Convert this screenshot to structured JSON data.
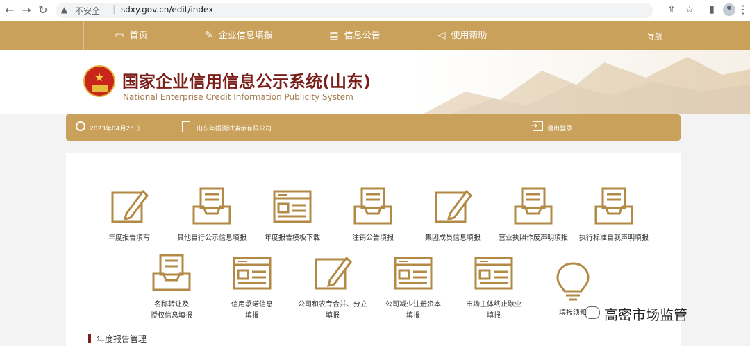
{
  "browser": {
    "insecure_label": "不安全",
    "url": "sdxy.gov.cn/edit/index"
  },
  "nav": {
    "items": [
      {
        "label": "首页",
        "icon": "monitor-icon"
      },
      {
        "label": "企业信息填报",
        "icon": "pen-icon"
      },
      {
        "label": "信息公告",
        "icon": "document-icon"
      },
      {
        "label": "使用帮助",
        "icon": "speaker-icon"
      }
    ],
    "guide": "导航"
  },
  "header": {
    "title_cn": "国家企业信用信息公示系统(山东)",
    "title_en": "National Enterprise Credit Information Publicity System"
  },
  "infobar": {
    "date": "2023年04月25日",
    "company": "山东年报测试演示有限公司",
    "logout": "退出登录"
  },
  "tiles": [
    {
      "label": "年度报告填写",
      "icon": "edit-icon"
    },
    {
      "label": "其他自行公示信息填报",
      "icon": "inbox-icon"
    },
    {
      "label": "年度报告模板下载",
      "icon": "form-icon"
    },
    {
      "label": "注销公告填报",
      "icon": "inbox-icon"
    },
    {
      "label": "集团成员信息填报",
      "icon": "edit-icon"
    },
    {
      "label": "营业执照作废声明填报",
      "icon": "inbox-icon"
    },
    {
      "label": "执行标准自我声明填报",
      "icon": "inbox-icon"
    },
    {
      "label": "名称转让及\n授权信息填报",
      "icon": "inbox-icon"
    },
    {
      "label": "信用承诺信息\n填报",
      "icon": "form-icon"
    },
    {
      "label": "公司和农专合并、分立\n填报",
      "icon": "edit-icon"
    },
    {
      "label": "公司减少注册资本\n填报",
      "icon": "form-icon"
    },
    {
      "label": "市场主体终止歇业\n填报",
      "icon": "form-icon"
    },
    {
      "label": "填报须知",
      "icon": "bulb-icon"
    }
  ],
  "section": {
    "title": "年度报告管理"
  },
  "watermark": {
    "text": "高密市场监管"
  },
  "colors": {
    "gold": "#c9a15b",
    "icon_gold": "#b38a45",
    "brand_red": "#7a1f1a"
  }
}
